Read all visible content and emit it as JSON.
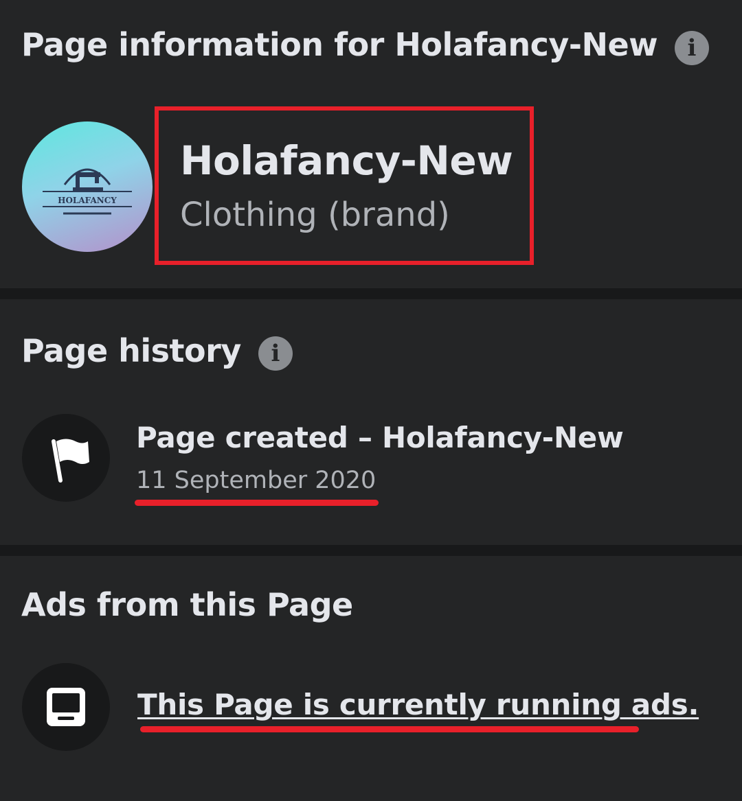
{
  "page_info": {
    "title": "Page information for Holafancy-New",
    "page_name": "Holafancy-New",
    "category": "Clothing (brand)",
    "avatar_logo_text": "HOLAFANCY",
    "info_icon": "info-icon"
  },
  "page_history": {
    "title": "Page history",
    "info_icon": "info-icon",
    "event": {
      "icon": "flag-icon",
      "label": "Page created – Holafancy-New",
      "date": "11 September 2020"
    }
  },
  "ads": {
    "title": "Ads from this Page",
    "icon": "ad-screen-icon",
    "status": "This Page is currently running ads."
  },
  "colors": {
    "background": "#242526",
    "divider": "#18191a",
    "text_primary": "#e4e6eb",
    "text_secondary": "#b0b3b8",
    "annotation_red": "#e8202a"
  }
}
